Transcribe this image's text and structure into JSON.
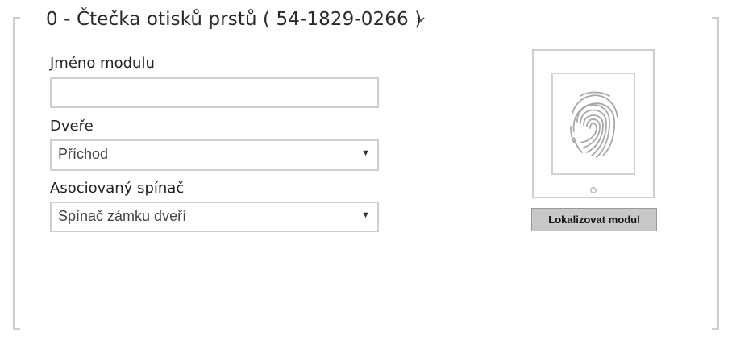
{
  "module": {
    "title": "0 - Čtečka otisků prstů ( 54-1829-0266 )",
    "icons": {
      "collapse": "chevron-down-icon",
      "device": "fingerprint-reader-icon"
    }
  },
  "form": {
    "name_label": "Jméno modulu",
    "name_value": "",
    "door_label": "Dveře",
    "door_value": "Příchod",
    "switch_label": "Asociovaný spínač",
    "switch_value": "Spínač zámku dveří"
  },
  "locate_button": "Lokalizovat modul"
}
